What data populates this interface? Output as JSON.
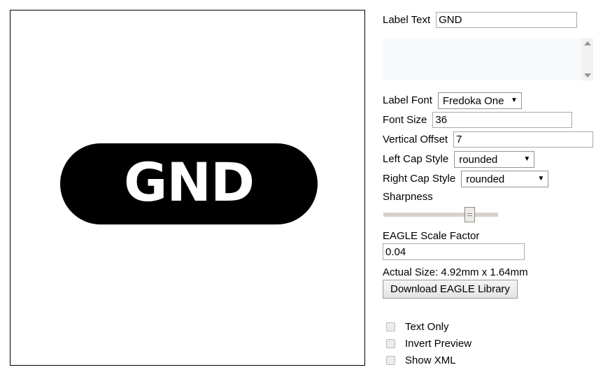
{
  "preview": {
    "label_text": "GND",
    "left_cap": "rounded",
    "right_cap": "rounded",
    "fg_color": "#ffffff",
    "bg_color": "#000000"
  },
  "form": {
    "label_text": {
      "label": "Label Text",
      "value": "GND",
      "placeholder": ""
    },
    "xml_output": {
      "value": "",
      "placeholder": ""
    },
    "label_font": {
      "label": "Label Font",
      "value": "Fredoka One",
      "caret": "▼",
      "options": [
        "Fredoka One"
      ]
    },
    "font_size": {
      "label": "Font Size",
      "value": "36"
    },
    "vertical_offset": {
      "label": "Vertical Offset",
      "value": "7"
    },
    "left_cap_style": {
      "label": "Left Cap Style",
      "value": "rounded",
      "caret": "▼",
      "options": [
        "rounded"
      ]
    },
    "right_cap_style": {
      "label": "Right Cap Style",
      "value": "rounded",
      "caret": "▼",
      "options": [
        "rounded"
      ]
    },
    "sharpness": {
      "label": "Sharpness"
    },
    "eagle_scale_factor": {
      "label": "EAGLE Scale Factor",
      "value": "0.04"
    },
    "actual_size": "Actual Size: 4.92mm x 1.64mm",
    "download_button": "Download EAGLE Library",
    "checkboxes": [
      {
        "label": "Text Only"
      },
      {
        "label": "Invert Preview"
      },
      {
        "label": "Show XML"
      }
    ]
  }
}
